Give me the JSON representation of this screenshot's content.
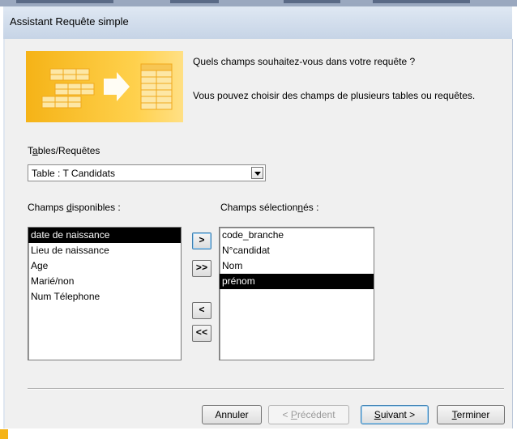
{
  "window": {
    "title": "Assistant Requête simple"
  },
  "intro": {
    "question": "Quels champs souhaitez-vous dans votre requête ?",
    "hint": "Vous pouvez choisir des champs de plusieurs tables ou requêtes."
  },
  "tables": {
    "label_pre": "T",
    "label_key": "a",
    "label_post": "bles/Requêtes",
    "selected": "Table : T Candidats"
  },
  "available": {
    "label_pre": "Champs ",
    "label_key": "d",
    "label_post": "isponibles :",
    "items": [
      "date de naissance",
      "Lieu de naissance",
      "Age",
      "Marié/non",
      "Num Télephone"
    ],
    "selected_index": 0
  },
  "selected_fields": {
    "label_pre": "Champs sélection",
    "label_key": "n",
    "label_post": "és :",
    "items": [
      "code_branche",
      "N°candidat",
      "Nom",
      "prénom"
    ],
    "selected_index": 3
  },
  "move": {
    "add_one": ">",
    "add_all": ">>",
    "remove_one": "<",
    "remove_all": "<<"
  },
  "buttons": {
    "cancel": "Annuler",
    "back_pre": "< ",
    "back_key": "P",
    "back_post": "récédent",
    "next_key": "S",
    "next_post": "uivant >",
    "finish_key": "T",
    "finish_post": "erminer"
  }
}
